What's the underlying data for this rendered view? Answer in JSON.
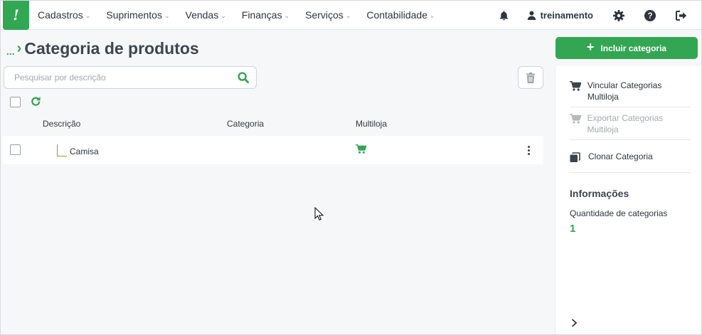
{
  "app": {
    "logo_text": "!"
  },
  "nav": {
    "items": [
      {
        "label": "Cadastros"
      },
      {
        "label": "Suprimentos"
      },
      {
        "label": "Vendas"
      },
      {
        "label": "Finanças"
      },
      {
        "label": "Serviços"
      },
      {
        "label": "Contabilidade"
      }
    ]
  },
  "header": {
    "username": "treinamento",
    "icons": [
      "bell-icon",
      "user-icon",
      "gear-icon",
      "help-icon",
      "logout-icon"
    ]
  },
  "page": {
    "breadcrumb_dots": "...",
    "breadcrumb_arrow": "›",
    "title": "Categoria de produtos"
  },
  "search": {
    "placeholder": "Pesquisar por descrição",
    "value": ""
  },
  "table": {
    "columns": [
      "Descrição",
      "Categoria",
      "Multiloja"
    ],
    "rows": [
      {
        "descricao": "Camisa",
        "categoria": "",
        "multiloja_icon": "cart-icon"
      }
    ]
  },
  "sidebar": {
    "add_button": "Incluir categoria",
    "actions": [
      {
        "label": "Vincular Categorias Multiloja",
        "icon": "cart-icon",
        "enabled": true
      },
      {
        "label": "Exportar Categorias Multiloja",
        "icon": "cart-icon",
        "enabled": false
      },
      {
        "label": "Clonar Categoria",
        "icon": "clone-icon",
        "enabled": true
      }
    ],
    "info_title": "Informações",
    "info_label": "Quantidade de categorias",
    "info_value": "1"
  },
  "colors": {
    "brand_green": "#33a653",
    "text_dark": "#2b3640",
    "disabled_text": "#a3aab0"
  }
}
